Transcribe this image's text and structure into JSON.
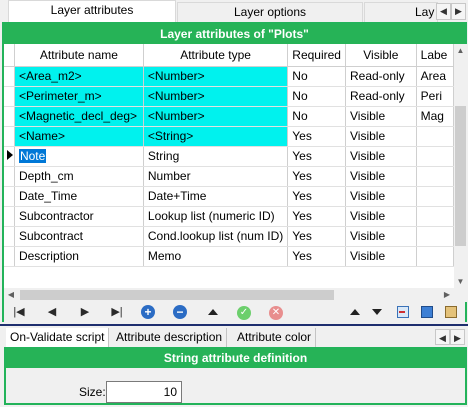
{
  "tabs": [
    {
      "label": "Layer attributes",
      "active": true
    },
    {
      "label": "Layer options",
      "active": false
    },
    {
      "label": "Lay",
      "active": false
    }
  ],
  "panel_title": "Layer attributes of \"Plots\"",
  "columns": [
    "Attribute name",
    "Attribute type",
    "Required",
    "Visible",
    "Labe"
  ],
  "rows": [
    {
      "name": "<Area_m2>",
      "type": "<Number>",
      "required": "No",
      "visible": "Read-only",
      "label": "Area",
      "system": true,
      "current": false
    },
    {
      "name": "<Perimeter_m>",
      "type": "<Number>",
      "required": "No",
      "visible": "Read-only",
      "label": "Peri",
      "system": true,
      "current": false
    },
    {
      "name": "<Magnetic_decl_deg>",
      "type": "<Number>",
      "required": "No",
      "visible": "Visible",
      "label": "Mag",
      "system": true,
      "current": false
    },
    {
      "name": "<Name>",
      "type": "<String>",
      "required": "Yes",
      "visible": "Visible",
      "label": "",
      "system": true,
      "current": false
    },
    {
      "name": "Note",
      "type": "String",
      "required": "Yes",
      "visible": "Visible",
      "label": "",
      "system": false,
      "current": true
    },
    {
      "name": "Depth_cm",
      "type": "Number",
      "required": "Yes",
      "visible": "Visible",
      "label": "",
      "system": false,
      "current": false
    },
    {
      "name": "Date_Time",
      "type": "Date+Time",
      "required": "Yes",
      "visible": "Visible",
      "label": "",
      "system": false,
      "current": false
    },
    {
      "name": "Subcontractor",
      "type": "Lookup list (numeric ID)",
      "required": "Yes",
      "visible": "Visible",
      "label": "",
      "system": false,
      "current": false
    },
    {
      "name": "Subcontract",
      "type": "Cond.lookup list (num ID)",
      "required": "Yes",
      "visible": "Visible",
      "label": "",
      "system": false,
      "current": false
    },
    {
      "name": "Description",
      "type": "Memo",
      "required": "Yes",
      "visible": "Visible",
      "label": "",
      "system": false,
      "current": false
    }
  ],
  "navigator": {
    "first": "first-record-icon",
    "prev": "prev-record-icon",
    "next": "next-record-icon",
    "last": "last-record-icon",
    "insert": "+",
    "delete": "−",
    "edit": "▲",
    "post": "✓",
    "cancel": "✕"
  },
  "bottom_tabs": [
    {
      "label": "On-Validate script",
      "active": true
    },
    {
      "label": "Attribute description",
      "active": false
    },
    {
      "label": "Attribute color",
      "active": false
    }
  ],
  "definition": {
    "title": "String attribute definition",
    "size_label": "Size:",
    "size_value": "10"
  },
  "colors": {
    "accent": "#26b357",
    "system_row": "#00f2ee",
    "selection": "#0078d7"
  }
}
